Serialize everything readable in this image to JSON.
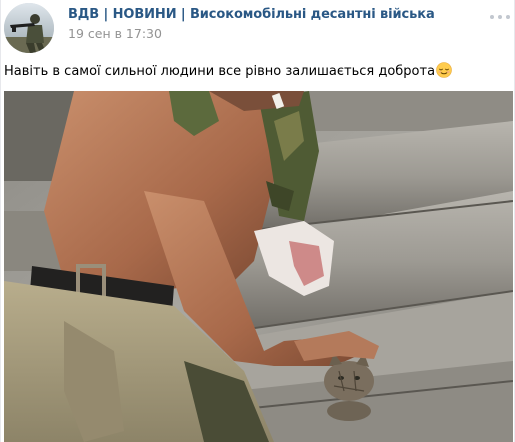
{
  "post": {
    "author": "ВДВ | НОВИНИ | Високомобільні десантні війська",
    "date": "19 сен в 17:30",
    "text": "Навіть в самої сильної людини все рівно залишається доброта",
    "emoji": "relieved-face-emoji",
    "more_icon": "three-dots-icon",
    "avatar_icon": "paratrooper-soldier-avatar"
  },
  "photo": {
    "subject": "shirtless soldier with bandaged hand petting a kitten on logs"
  },
  "colors": {
    "author_link": "#2a5885",
    "meta": "#939393",
    "text": "#000000"
  }
}
